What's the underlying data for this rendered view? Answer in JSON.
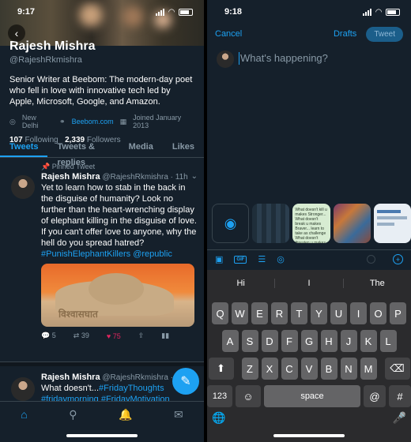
{
  "left": {
    "status": {
      "time": "9:17"
    },
    "profile": {
      "name": "Rajesh Mishra",
      "handle": "@RajeshRkmishra",
      "bio": "Senior Writer at Beebom: The modern-day poet who fell in love with innovative tech led by Apple, Microsoft, Google, and Amazon.",
      "location": "New Delhi",
      "website": "Beebom.com",
      "joined": "Joined January 2013",
      "following_count": "107",
      "following_label": "Following",
      "followers_count": "2,339",
      "followers_label": "Followers"
    },
    "tabs": [
      "Tweets",
      "Tweets & replies",
      "Media",
      "Likes"
    ],
    "pinned_label": "Pinned Tweet",
    "tweet1": {
      "name": "Rajesh Mishra",
      "meta": "@RajeshRkmishra · 11h",
      "text": "Yet to learn how to stab in the back in the disguise of humanity? Look no further than the heart-wrenching display of elephant killing in the disguise of love. If you can't offer love to anyone, why the hell do you spread hatred?",
      "hashtag": "#PunishElephantKillers",
      "mention": "@republic",
      "image_caption": "विश्वासघात",
      "replies": "5",
      "retweets": "39",
      "likes": "75"
    },
    "tweet2": {
      "name": "Rajesh Mishra",
      "meta": "@RajeshRkmishra · 4h",
      "text": "What doesn't...",
      "hashtag1": "#FridayThoughts",
      "hashtag2": "#fridaymorning",
      "hashtag3": "#FridayMotivation"
    },
    "icons": [
      "back-icon",
      "location-icon",
      "link-icon",
      "calendar-icon",
      "pin-icon",
      "reply-icon",
      "retweet-icon",
      "like-icon",
      "share-icon",
      "analytics-icon",
      "compose-icon",
      "home-icon",
      "search-icon",
      "notifications-icon",
      "messages-icon"
    ]
  },
  "right": {
    "status": {
      "time": "9:18"
    },
    "cancel": "Cancel",
    "drafts": "Drafts",
    "tweet_button": "Tweet",
    "placeholder": "What's happening?",
    "thumb_text": "What doesn't kill u makes Stronger... What doesn't break u makes Braver... learn to take as challenge What doesn't threaten u makes u a FIGHTER!",
    "suggestions": [
      "Hi",
      "I",
      "The"
    ],
    "rows": [
      [
        "Q",
        "W",
        "E",
        "R",
        "T",
        "Y",
        "U",
        "I",
        "O",
        "P"
      ],
      [
        "A",
        "S",
        "D",
        "F",
        "G",
        "H",
        "J",
        "K",
        "L"
      ],
      [
        "Z",
        "X",
        "C",
        "V",
        "B",
        "N",
        "M"
      ]
    ],
    "key_numbers": "123",
    "key_space": "space",
    "key_at": "@",
    "key_hash": "#",
    "key_emoji": "☺",
    "key_shift": "⬆",
    "key_delete": "⌫",
    "key_globe": "🌐",
    "key_mic": "🎤",
    "tool_icons": [
      "image-icon",
      "gif-icon",
      "poll-icon",
      "location-icon",
      "progress-ring-icon",
      "add-thread-icon"
    ]
  },
  "colors": {
    "accent": "#1da1f2",
    "background": "#15202b",
    "muted": "#8899a6",
    "like": "#e0245e"
  }
}
